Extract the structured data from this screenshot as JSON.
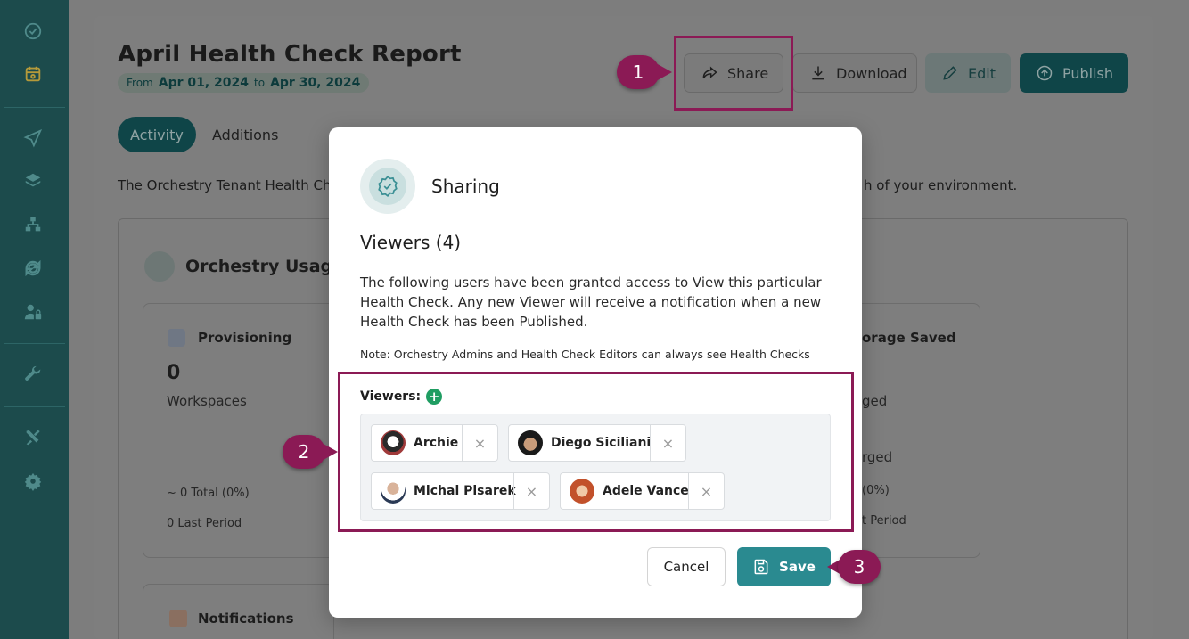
{
  "sidebar": {
    "icons": [
      "dashboard-check-icon",
      "calendar-icon",
      "send-icon",
      "layers-icon",
      "hierarchy-icon",
      "sync-icon",
      "user-lock-icon",
      "wrench-icon",
      "tools-icon",
      "gear-icon"
    ]
  },
  "header": {
    "title": "April Health Check Report",
    "from_label": "From",
    "from_date": "Apr 01, 2024",
    "to_label": "to",
    "to_date": "Apr 30, 2024"
  },
  "toolbar": {
    "share_label": "Share",
    "download_label": "Download",
    "edit_label": "Edit",
    "publish_label": "Publish"
  },
  "tabs": [
    {
      "label": "Activity",
      "active": true
    },
    {
      "label": "Additions",
      "active": false
    }
  ],
  "description_left": "The Orchestry Tenant Health Ch",
  "description_right": "h of your environment.",
  "usage": {
    "title": "Orchestry Usage",
    "provisioning": {
      "title": "Provisioning",
      "value": "0",
      "unit": "Workspaces",
      "total": "0 Total (0%)",
      "last_period": "0 Last Period"
    },
    "storage": {
      "title_fragment": "orage Saved",
      "line1": "ged",
      "line2": "rged",
      "pct": "(0%)",
      "last_period": "t Period"
    },
    "notifications": {
      "title": "Notifications"
    }
  },
  "modal": {
    "title": "Sharing",
    "viewers_heading": "Viewers (4)",
    "paragraph": "The following users have been granted access to View this particular Health Check. Any new Viewer will receive a notification when a new Health Check has been Published.",
    "note": "Note: Orchestry Admins and Health Check Editors can always see Health Checks",
    "viewers_label": "Viewers:",
    "add_symbol": "+",
    "viewers": [
      {
        "name": "Archie"
      },
      {
        "name": "Diego Siciliani"
      },
      {
        "name": "Michal Pisarek"
      },
      {
        "name": "Adele Vance"
      }
    ],
    "remove_symbol": "×",
    "cancel_label": "Cancel",
    "save_label": "Save"
  },
  "callouts": [
    "1",
    "2",
    "3"
  ],
  "colors": {
    "accent": "#8b1a55",
    "primary": "#2a8a90",
    "sidebar": "#1c4b4c",
    "success": "#1f9d62"
  }
}
